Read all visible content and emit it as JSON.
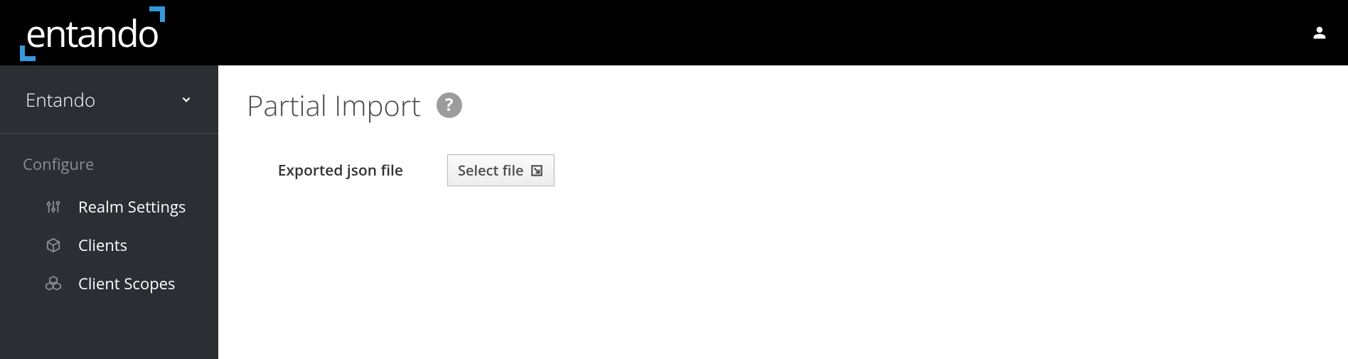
{
  "header": {
    "brand": "entando"
  },
  "sidebar": {
    "realm": "Entando",
    "section_label": "Configure",
    "items": [
      {
        "label": "Realm Settings"
      },
      {
        "label": "Clients"
      },
      {
        "label": "Client Scopes"
      }
    ]
  },
  "main": {
    "title": "Partial Import",
    "form": {
      "file_label": "Exported json file",
      "select_button": "Select file"
    }
  }
}
